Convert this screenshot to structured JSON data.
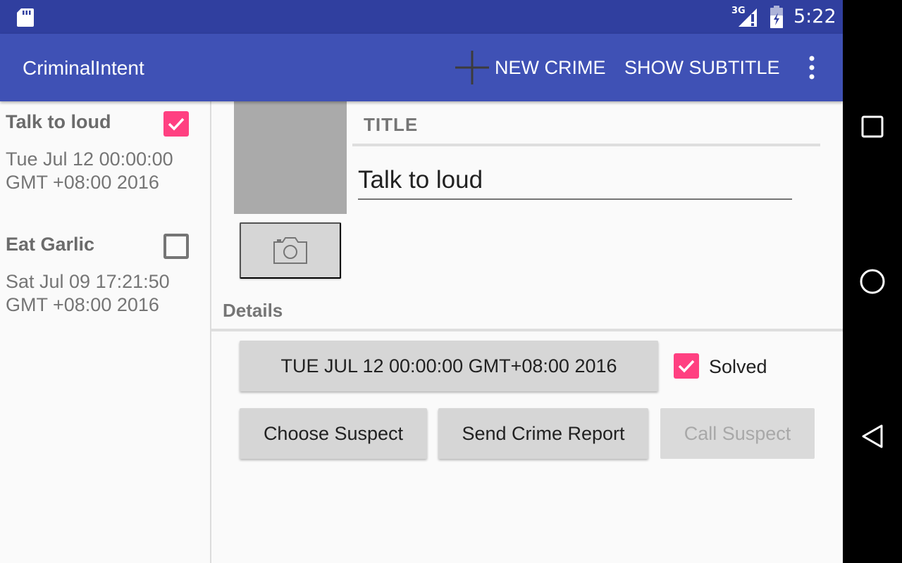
{
  "status_bar": {
    "network": "3G",
    "time": "5:22",
    "icons": [
      "sd-card-icon",
      "signal-icon",
      "battery-icon"
    ]
  },
  "app_bar": {
    "title": "CriminalIntent",
    "new_crime_label": "NEW CRIME",
    "show_subtitle_label": "SHOW SUBTITLE",
    "icons": [
      "plus-icon",
      "overflow-menu-icon"
    ]
  },
  "crime_list": [
    {
      "title": "Talk to loud",
      "date": "Tue Jul 12 00:00:00 GMT +08:00 2016",
      "solved": true
    },
    {
      "title": "Eat Garlic",
      "date": "Sat Jul 09 17:21:50 GMT +08:00 2016",
      "solved": false
    }
  ],
  "detail": {
    "title_header": "TITLE",
    "title_value": "Talk to loud",
    "details_header": "Details",
    "date_button": "TUE JUL 12 00:00:00 GMT+08:00 2016",
    "solved_label": "Solved",
    "solved": true,
    "choose_suspect": "Choose Suspect",
    "send_report": "Send Crime Report",
    "call_suspect": "Call Suspect",
    "icons": [
      "camera-icon"
    ]
  },
  "nav_bar": {
    "icons": [
      "recents-icon",
      "home-icon",
      "back-icon"
    ]
  },
  "colors": {
    "primary": "#3f51b5",
    "primary_dark": "#303f9f",
    "accent": "#ff4081"
  }
}
